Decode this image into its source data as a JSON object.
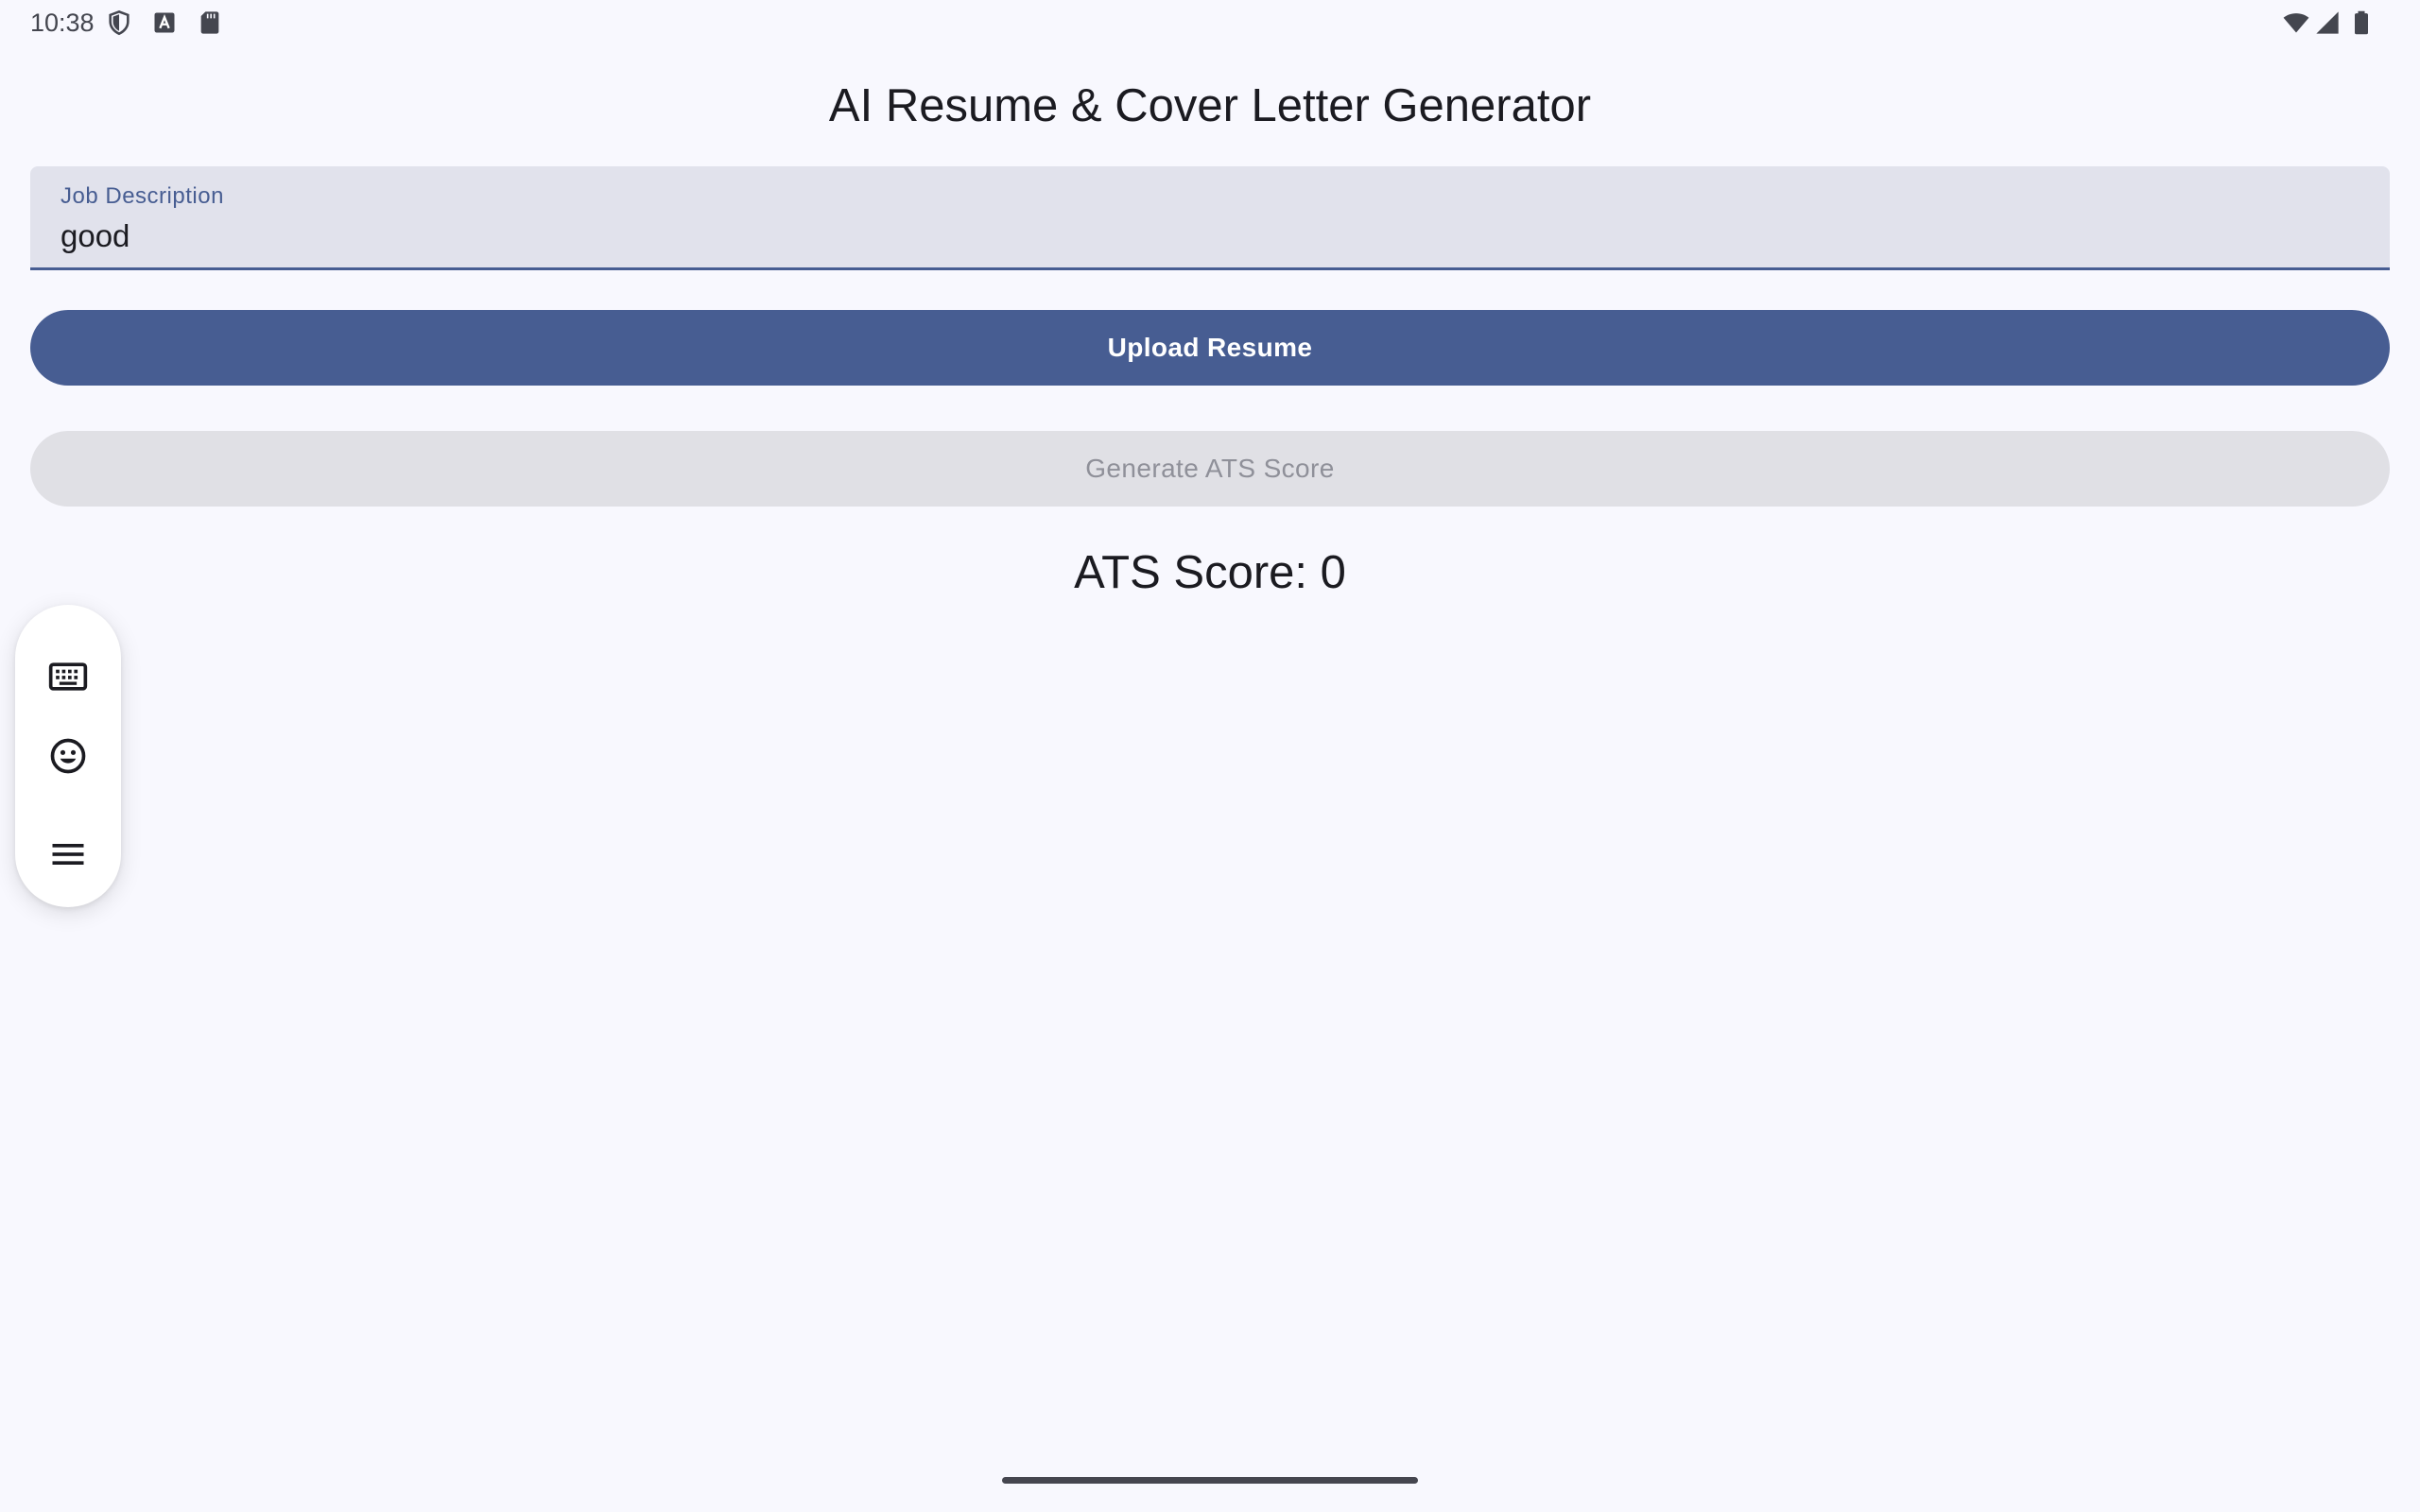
{
  "status_bar": {
    "time": "10:38",
    "left_icons": [
      "shield-icon",
      "font-a-icon",
      "sd-card-icon"
    ],
    "right_icons": [
      "wifi-icon",
      "cell-signal-icon",
      "battery-icon"
    ]
  },
  "app": {
    "title": "AI Resume & Cover Letter Generator"
  },
  "job_description": {
    "label": "Job Description",
    "value": "good"
  },
  "buttons": {
    "upload_resume": "Upload Resume",
    "generate_ats": "Generate ATS Score"
  },
  "ats": {
    "score_text": "ATS Score: 0"
  },
  "floating_toolbar": {
    "icons": [
      "keyboard-icon",
      "emoji-icon",
      "menu-icon"
    ]
  },
  "colors": {
    "background": "#f8f8fe",
    "primary": "#475d92",
    "field_background": "#e1e2ec",
    "disabled_background": "#e0e0e5",
    "disabled_text": "#8f9099"
  }
}
